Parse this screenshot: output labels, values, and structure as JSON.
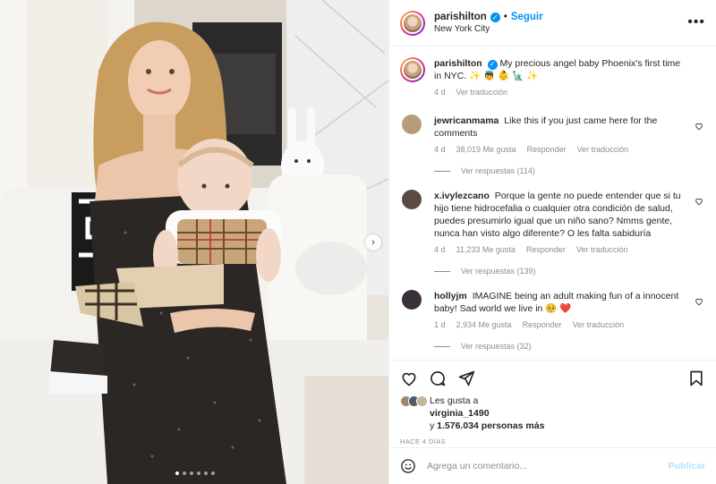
{
  "post": {
    "username": "parishilton",
    "follow_label": "Seguir",
    "location": "New York City",
    "more_icon": "more-options-icon"
  },
  "caption": {
    "username": "parishilton",
    "text": "My precious angel baby Phoenix's first time in NYC. ✨ 👼 👶 🗽 ✨",
    "time": "4 d",
    "translate": "Ver traducción"
  },
  "comments": [
    {
      "username": "jewricanmama",
      "text": "Like this if you just came here for the comments",
      "time": "4 d",
      "likes": "38,019 Me gusta",
      "reply": "Responder",
      "translate": "Ver traducción",
      "replies": "Ver respuestas (114)",
      "avatar_color": "#b79c7a"
    },
    {
      "username": "x.ivylezcano",
      "text": "Porque la gente no puede entender que si tu hijo tiene hidrocefalia o cualquier otra condición de salud, puedes presumirlo igual que un niño sano? Nmms gente, nunca han visto algo diferente? O les falta sabiduría",
      "time": "4 d",
      "likes": "11,233 Me gusta",
      "reply": "Responder",
      "translate": "Ver traducción",
      "replies": "Ver respuestas (139)",
      "avatar_color": "#5a4a42"
    },
    {
      "username": "hollyjm",
      "text": "IMAGINE being an adult making fun of a innocent baby! Sad world we live in 🥺 ❤️",
      "time": "1 d",
      "likes": "2,934 Me gusta",
      "reply": "Responder",
      "translate": "Ver traducción",
      "replies": "Ver respuestas (32)",
      "avatar_color": "#3b2f3a"
    }
  ],
  "likes": {
    "prefix": "Les gusta a",
    "user": "virginia_1490",
    "and": "y",
    "count": "1.576.034 personas más"
  },
  "posted_ago": "HACE 4 DÍAS",
  "comment_box": {
    "placeholder": "Agrega un comentario...",
    "publish": "Publicar"
  },
  "carousel": {
    "next_icon": "chevron-right-icon",
    "slide_count": 6,
    "active_index": 0
  },
  "colors": {
    "accent": "#0095f6",
    "muted": "#8e8e8e",
    "heart_red": "#ed4956"
  }
}
